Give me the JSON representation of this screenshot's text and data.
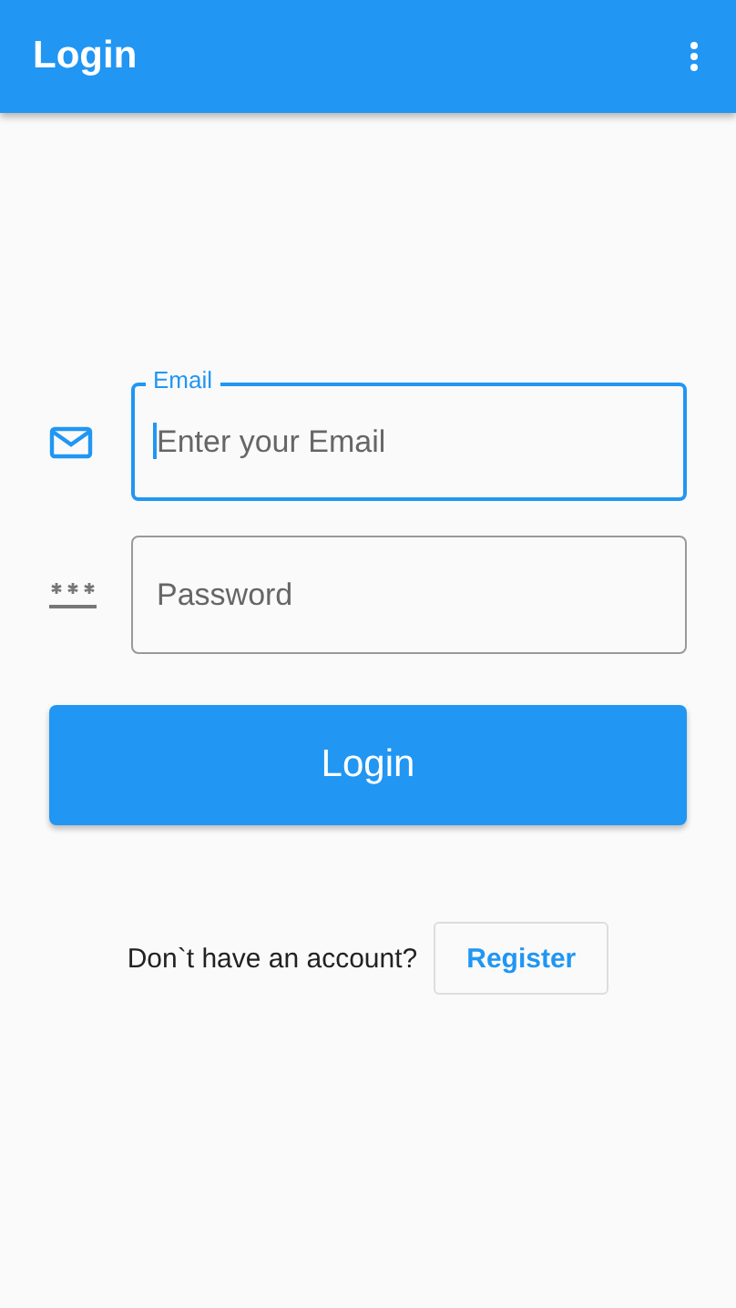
{
  "app_bar": {
    "title": "Login"
  },
  "fields": [
    {
      "kind": "email",
      "label": "Email",
      "placeholder": "Enter your Email",
      "focused": true
    },
    {
      "kind": "password",
      "placeholder": "Password",
      "focused": false
    }
  ],
  "login_button": "Login",
  "register_row": {
    "prompt": "Don`t have an account?",
    "button": "Register"
  }
}
